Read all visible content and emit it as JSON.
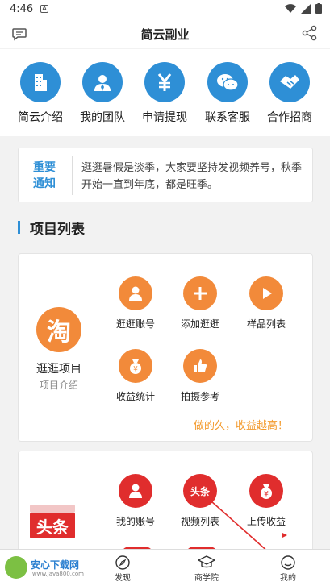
{
  "status_bar": {
    "time": "4:46",
    "notification": "A"
  },
  "header": {
    "title": "简云副业"
  },
  "quick_actions": [
    {
      "label": "简云介绍",
      "icon": "building-icon"
    },
    {
      "label": "我的团队",
      "icon": "team-icon"
    },
    {
      "label": "申请提现",
      "icon": "yen-icon"
    },
    {
      "label": "联系客服",
      "icon": "wechat-icon"
    },
    {
      "label": "合作招商",
      "icon": "handshake-icon"
    }
  ],
  "notice": {
    "tag_line1": "重要",
    "tag_line2": "通知",
    "text": "逛逛暑假是淡季，大家要坚持发视频养号，秋季开始一直到年底，都是旺季。"
  },
  "section": {
    "title": "项目列表"
  },
  "project1": {
    "logo_char": "淘",
    "name": "逛逛项目",
    "subtitle": "项目介绍",
    "items": [
      {
        "label": "逛逛账号",
        "icon": "user-icon"
      },
      {
        "label": "添加逛逛",
        "icon": "plus-icon"
      },
      {
        "label": "样品列表",
        "icon": "play-icon"
      },
      {
        "label": "收益统计",
        "icon": "money-bag-icon"
      },
      {
        "label": "拍摄参考",
        "icon": "thumbs-up-icon"
      }
    ],
    "slogan": "做的久，收益越高！"
  },
  "project2": {
    "logo_text": "头条",
    "items": [
      {
        "label": "我的账号",
        "icon": "user-icon"
      },
      {
        "label": "视频列表",
        "icon": "toutiao-icon",
        "icon_text": "头条"
      },
      {
        "label": "上传收益",
        "icon": "money-bag-icon"
      }
    ]
  },
  "tabbar": {
    "tabs": [
      {
        "label": "发现",
        "icon": "compass-icon"
      },
      {
        "label": "商学院",
        "icon": "graduation-cap-icon"
      },
      {
        "label": "我的",
        "icon": "chat-icon"
      }
    ]
  },
  "watermark": {
    "brand": "安心下载网",
    "url": "www.java800.com"
  },
  "colors": {
    "primary": "#2e8fd6",
    "orange": "#f28a3a",
    "red": "#e02d2d",
    "slogan": "#f39a2c"
  }
}
